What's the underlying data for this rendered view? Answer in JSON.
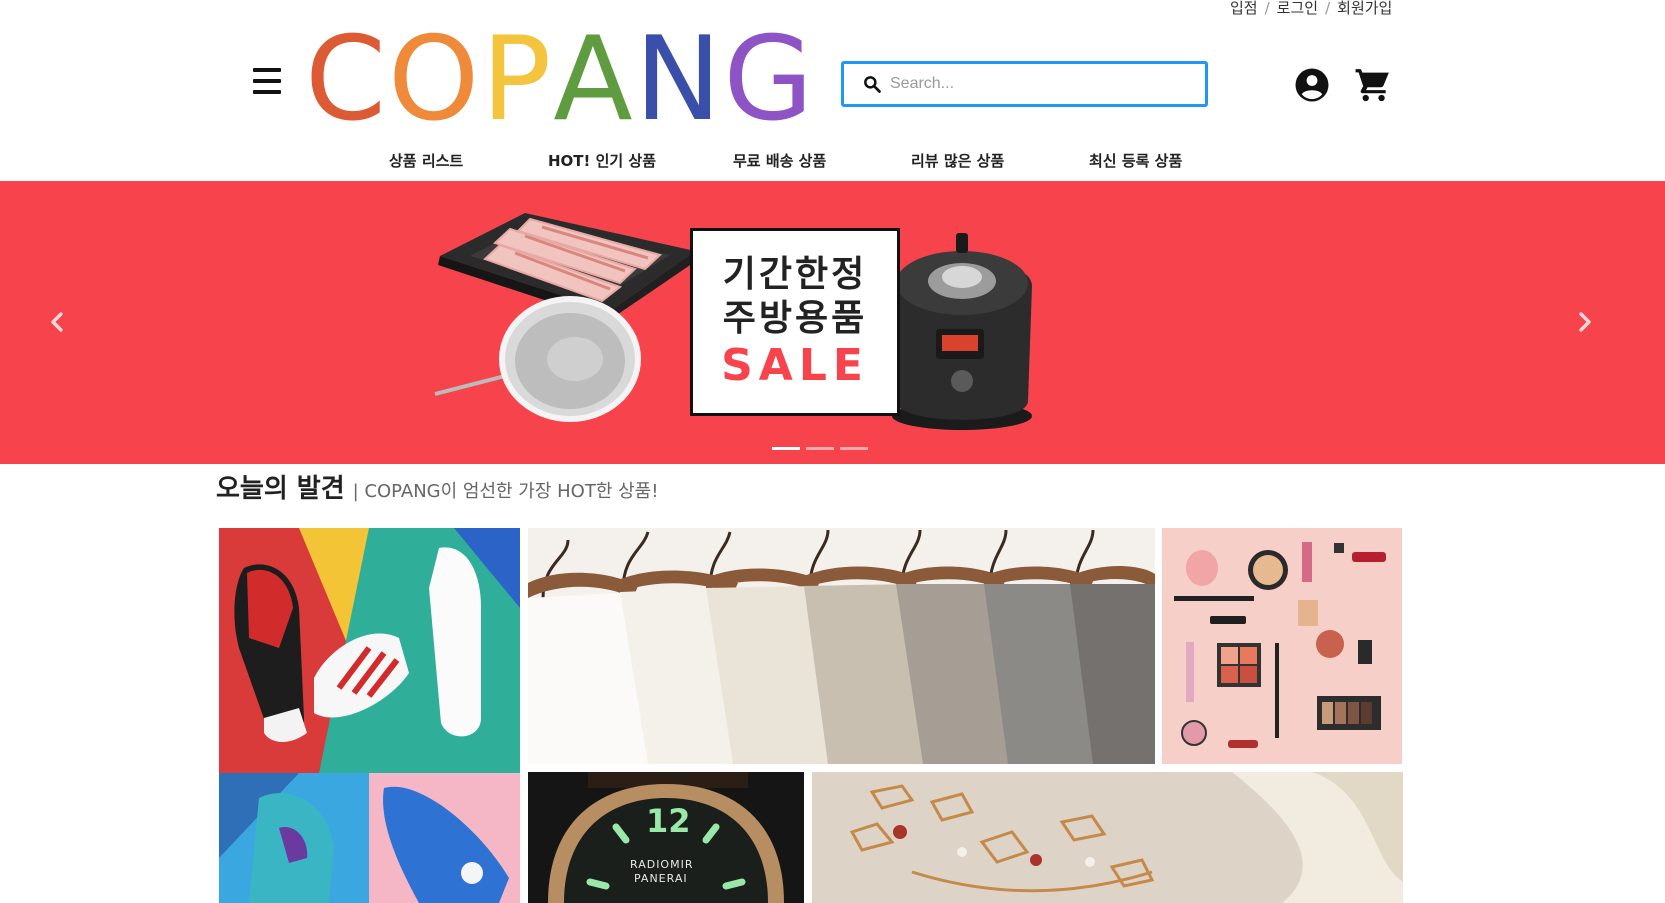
{
  "top_links": {
    "seller": "입점",
    "login": "로그인",
    "signup": "회원가입",
    "separator": "/"
  },
  "header": {
    "logo_letters": [
      "C",
      "O",
      "P",
      "A",
      "N",
      "G"
    ],
    "logo_colors": [
      "#dc5b35",
      "#ee8a3a",
      "#f4c43e",
      "#5e9c3f",
      "#3a4fa9",
      "#8e53c5"
    ],
    "search_placeholder": "Search...",
    "accent": "#2196f3"
  },
  "categories": [
    "상품 리스트",
    "HOT! 인기 상품",
    "무료 배송 상품",
    "리뷰 많은 상품",
    "최신 등록 상품"
  ],
  "banner": {
    "background": "#f7434b",
    "line1": "기간한정",
    "line2": "주방용품",
    "line3": "SALE",
    "slide_count": 3,
    "active_slide": 1
  },
  "section": {
    "title": "오늘의 발견",
    "subtitle": "| COPANG이 엄선한 가장 HOT한 상품!"
  },
  "tiles": [
    {
      "name": "sneakers"
    },
    {
      "name": "shirts"
    },
    {
      "name": "cosmetics"
    },
    {
      "name": "watch",
      "label_line1": "RADIOMIR",
      "label_line2": "PANERAI",
      "numeral": "12"
    },
    {
      "name": "jewelry"
    }
  ],
  "icons": [
    "menu-icon",
    "search-icon",
    "account-icon",
    "cart-icon",
    "chevron-left-icon",
    "chevron-right-icon"
  ]
}
